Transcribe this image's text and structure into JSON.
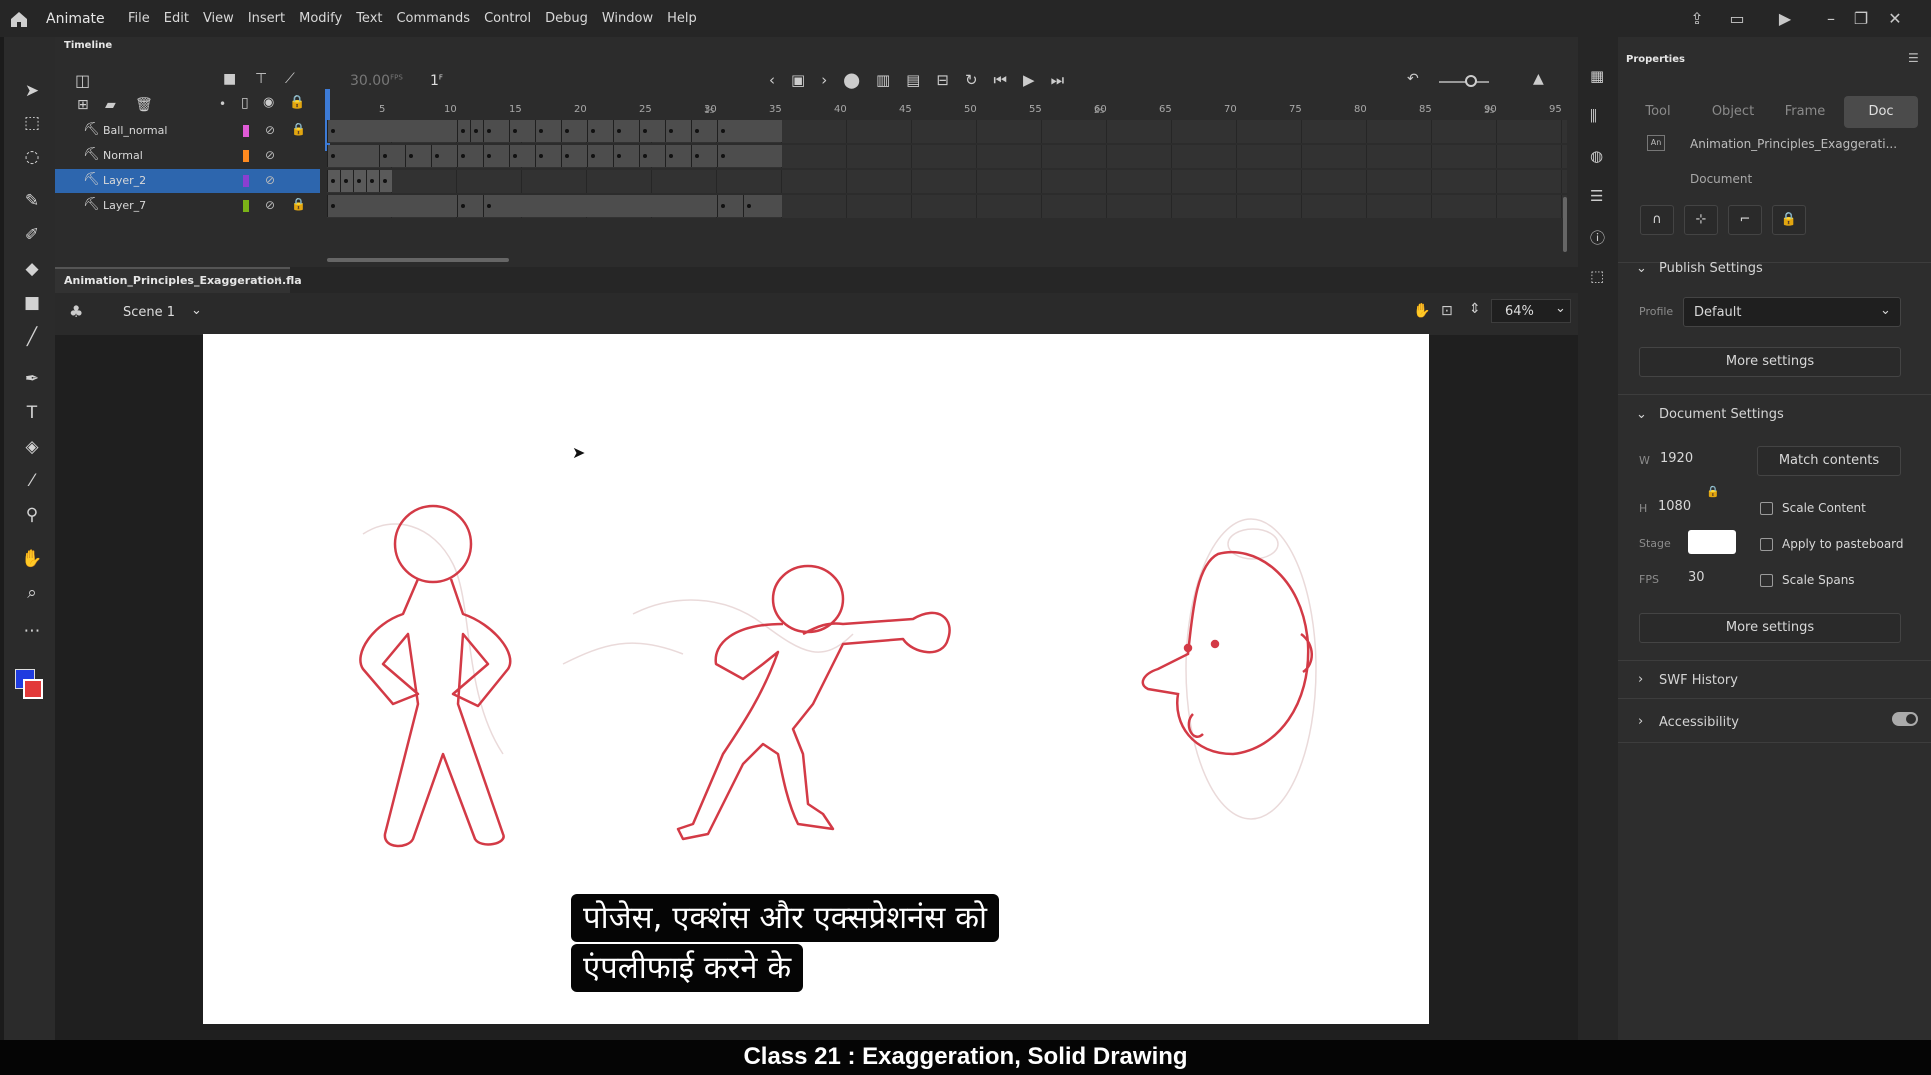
{
  "app": {
    "name": "Animate"
  },
  "menu": [
    "File",
    "Edit",
    "View",
    "Insert",
    "Modify",
    "Text",
    "Commands",
    "Control",
    "Debug",
    "Window",
    "Help"
  ],
  "timeline": {
    "title": "Timeline",
    "fps": "30.00",
    "fps_unit": "FPS",
    "frame": "1",
    "frame_unit": "F",
    "layers": [
      {
        "name": "Ball_normal",
        "color": "#e05bd7"
      },
      {
        "name": "Normal",
        "color": "#ff8a1f"
      },
      {
        "name": "Layer_2",
        "color": "#8a3fd1"
      },
      {
        "name": "Layer_7",
        "color": "#7ab317"
      }
    ],
    "ruler_numbers": [
      "5",
      "10",
      "15",
      "20",
      "25",
      "30",
      "35",
      "40",
      "45",
      "50",
      "55",
      "60",
      "65",
      "70",
      "75",
      "80",
      "85",
      "90",
      "95"
    ],
    "seconds_marks": [
      "1s",
      "2s",
      "3s"
    ]
  },
  "document": {
    "tab_name": "Animation_Principles_Exaggeration.fla",
    "scene": "Scene 1",
    "zoom": "64%"
  },
  "subtitle": {
    "line1": "पोजेस, एक्शंस और एक्सप्रेशनंस को",
    "line2": "एंपलीफाई करने के"
  },
  "properties": {
    "title": "Properties",
    "tabs": [
      "Tool",
      "Object",
      "Frame",
      "Doc"
    ],
    "doc_name": "Animation_Principles_Exaggerati...",
    "doc_type": "Document",
    "publish_settings": {
      "header": "Publish Settings",
      "profile_label": "Profile",
      "profile_value": "Default",
      "more_settings": "More settings"
    },
    "document_settings": {
      "header": "Document Settings",
      "w_label": "W",
      "w_value": "1920",
      "h_label": "H",
      "h_value": "1080",
      "match_contents": "Match contents",
      "scale_content": "Scale Content",
      "apply_pasteboard": "Apply to pasteboard",
      "scale_spans": "Scale Spans",
      "stage_label": "Stage",
      "fps_label": "FPS",
      "fps_value": "30",
      "more_settings": "More settings"
    },
    "swf_history": "SWF History",
    "accessibility": "Accessibility"
  },
  "footer": {
    "caption": "Class 21 : Exaggeration, Solid Drawing"
  },
  "colors": {
    "accent": "#2d66ae",
    "stroke": "#d33a46",
    "stage": "#ffffff"
  }
}
